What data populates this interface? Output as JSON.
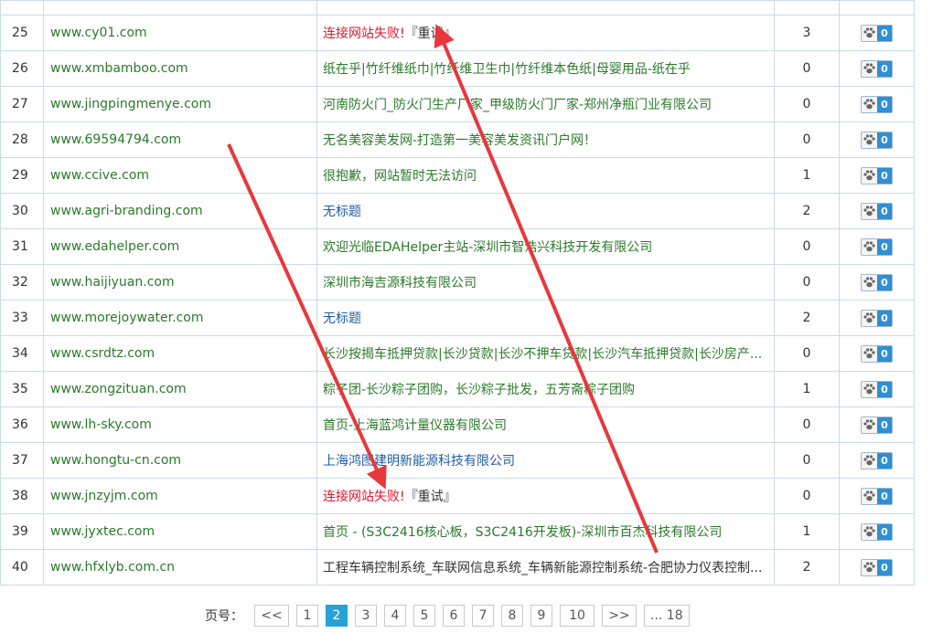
{
  "rows": [
    {
      "num": "25",
      "domain": "www.cy01.com",
      "title": "连接网站失败!",
      "retry": "『重试』",
      "title_style": "t-red",
      "count": "3",
      "badge": "0"
    },
    {
      "num": "26",
      "domain": "www.xmbamboo.com",
      "title": "纸在乎|竹纤维纸巾|竹纤维卫生巾|竹纤维本色纸|母婴用品-纸在乎",
      "retry": "",
      "title_style": "t-green",
      "count": "0",
      "badge": "0"
    },
    {
      "num": "27",
      "domain": "www.jingpingmenye.com",
      "title": "河南防火门_防火门生产厂家_甲级防火门厂家-郑州净瓶门业有限公司",
      "retry": "",
      "title_style": "t-green",
      "count": "0",
      "badge": "0"
    },
    {
      "num": "28",
      "domain": "www.69594794.com",
      "title": "无名美容美发网-打造第一美容美发资讯门户网！",
      "retry": "",
      "title_style": "t-green",
      "count": "0",
      "badge": "0"
    },
    {
      "num": "29",
      "domain": "www.ccive.com",
      "title": "很抱歉，网站暂时无法访问",
      "retry": "",
      "title_style": "t-green",
      "count": "1",
      "badge": "0"
    },
    {
      "num": "30",
      "domain": "www.agri-branding.com",
      "title": "无标题",
      "retry": "",
      "title_style": "t-blue",
      "count": "2",
      "badge": "0"
    },
    {
      "num": "31",
      "domain": "www.edahelper.com",
      "title": "欢迎光临EDAHelper主站-深圳市智浩兴科技开发有限公司",
      "retry": "",
      "title_style": "t-green",
      "count": "0",
      "badge": "0"
    },
    {
      "num": "32",
      "domain": "www.haijiyuan.com",
      "title": "深圳市海吉源科技有限公司",
      "retry": "",
      "title_style": "t-green",
      "count": "0",
      "badge": "0"
    },
    {
      "num": "33",
      "domain": "www.morejoywater.com",
      "title": "无标题",
      "retry": "",
      "title_style": "t-blue",
      "count": "2",
      "badge": "0"
    },
    {
      "num": "34",
      "domain": "www.csrdtz.com",
      "title": "长沙按揭车抵押贷款|长沙贷款|长沙不押车贷款|长沙汽车抵押贷款|长沙房产...",
      "retry": "",
      "title_style": "t-green",
      "count": "0",
      "badge": "0"
    },
    {
      "num": "35",
      "domain": "www.zongzituan.com",
      "title": "粽子团-长沙粽子团购，长沙粽子批发，五芳斋粽子团购",
      "retry": "",
      "title_style": "t-green",
      "count": "1",
      "badge": "0"
    },
    {
      "num": "36",
      "domain": "www.lh-sky.com",
      "title": "首页-上海蓝鸿计量仪器有限公司",
      "retry": "",
      "title_style": "t-green",
      "count": "0",
      "badge": "0"
    },
    {
      "num": "37",
      "domain": "www.hongtu-cn.com",
      "title": "上海鸿图建明新能源科技有限公司",
      "retry": "",
      "title_style": "t-blue",
      "count": "0",
      "badge": "0"
    },
    {
      "num": "38",
      "domain": "www.jnzyjm.com",
      "title": "连接网站失败!",
      "retry": "『重试』",
      "title_style": "t-red",
      "count": "0",
      "badge": "0"
    },
    {
      "num": "39",
      "domain": "www.jyxtec.com",
      "title": "首页 - (S3C2416核心板，S3C2416开发板)-深圳市百杰科技有限公司",
      "retry": "",
      "title_style": "t-green",
      "count": "1",
      "badge": "0"
    },
    {
      "num": "40",
      "domain": "www.hfxlyb.com.cn",
      "title": "工程车辆控制系统_车联网信息系统_车辆新能源控制系统-合肥协力仪表控制...",
      "retry": "",
      "title_style": "t-dark",
      "count": "2",
      "badge": "0"
    }
  ],
  "pager": {
    "label": "页号：",
    "prev": "<<",
    "pages": [
      "1",
      "2",
      "3",
      "4",
      "5",
      "6",
      "7",
      "8",
      "9",
      "10"
    ],
    "active": "2",
    "next": ">>",
    "last": "... 18"
  },
  "icons": {
    "row_action": "paw-icon"
  },
  "colors": {
    "link_green": "#2a7a2a",
    "error_red": "#e0182b",
    "badge_blue": "#2e8fd5",
    "pager_active": "#27a2d8",
    "annotation_arrow": "#e8383d"
  }
}
